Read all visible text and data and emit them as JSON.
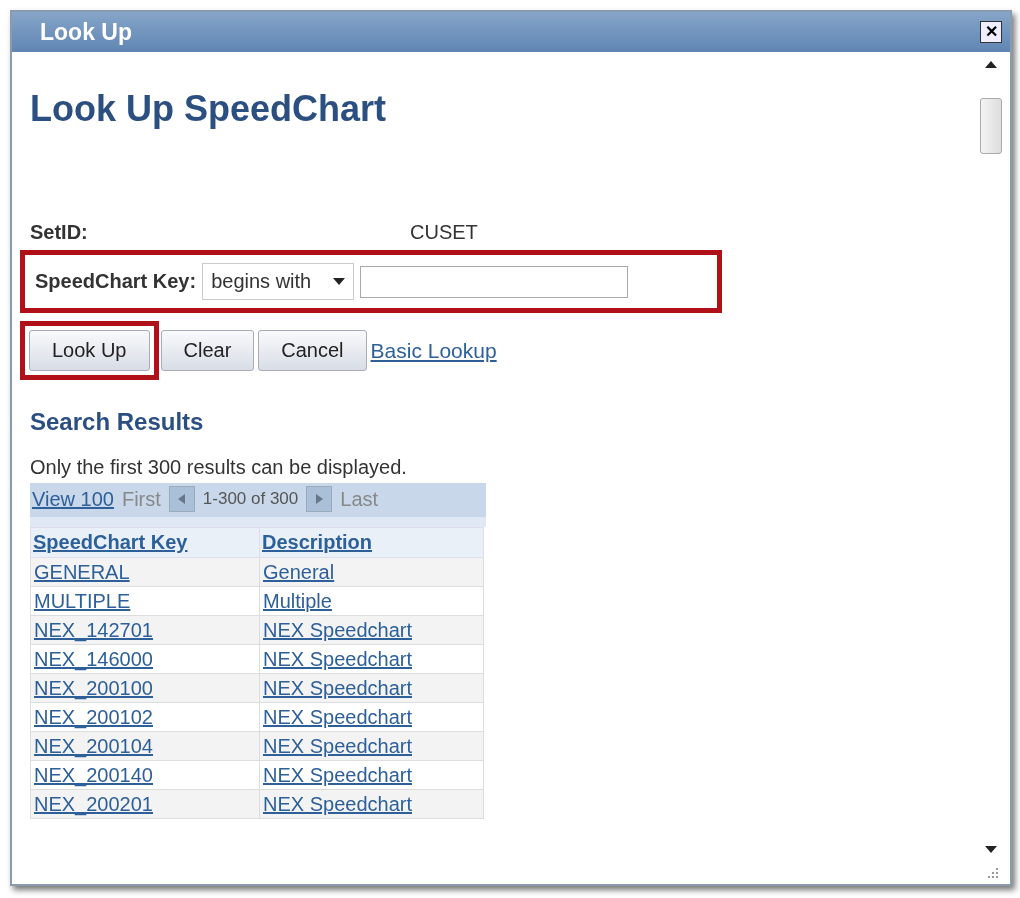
{
  "window": {
    "title": "Look Up",
    "close": "✕"
  },
  "heading": "Look Up SpeedChart",
  "setid": {
    "label": "SetID:",
    "value": "CUSET"
  },
  "criteria": {
    "label": "SpeedChart Key:",
    "operator": "begins with",
    "highlighted": true
  },
  "buttons": [
    {
      "label": "Look Up",
      "kind": "button",
      "highlighted": true
    },
    {
      "label": "Clear",
      "kind": "button",
      "highlighted": false
    },
    {
      "label": "Cancel",
      "kind": "button",
      "highlighted": false
    },
    {
      "label": "Basic Lookup",
      "kind": "link",
      "highlighted": false
    }
  ],
  "results": {
    "title": "Search Results",
    "note": "Only the first 300 results can be displayed.",
    "nav": {
      "view": "View 100",
      "first": "First",
      "range": "1-300 of 300",
      "last": "Last"
    },
    "columns": [
      "SpeedChart Key",
      "Description"
    ],
    "rows": [
      [
        "GENERAL",
        "General"
      ],
      [
        "MULTIPLE",
        "Multiple"
      ],
      [
        "NEX_142701",
        "NEX Speedchart"
      ],
      [
        "NEX_146000",
        "NEX Speedchart"
      ],
      [
        "NEX_200100",
        "NEX Speedchart"
      ],
      [
        "NEX_200102",
        "NEX Speedchart"
      ],
      [
        "NEX_200104",
        "NEX Speedchart"
      ],
      [
        "NEX_200140",
        "NEX Speedchart"
      ],
      [
        "NEX_200201",
        "NEX Speedchart"
      ]
    ]
  }
}
